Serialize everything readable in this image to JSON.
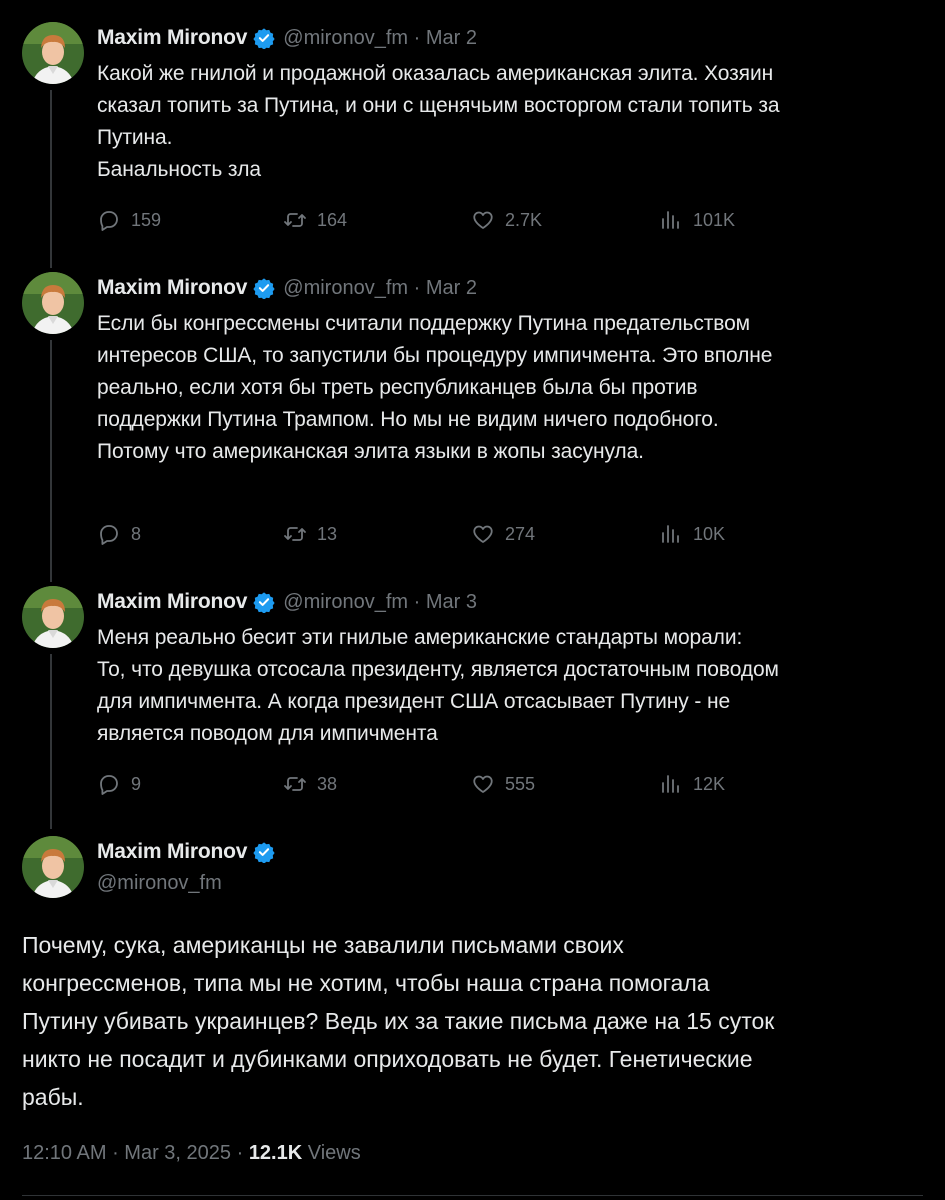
{
  "author": {
    "name": "Maxim Mironov",
    "handle": "@mironov_fm"
  },
  "thread": [
    {
      "date": "Mar 2",
      "lines": [
        "Какой же гнилой и продажной оказалась американская элита. Хозяин",
        "сказал топить за Путина, и они с щенячьим восторгом стали топить за",
        "Путина.",
        "Банальность зла"
      ],
      "replies": "159",
      "reposts": "164",
      "likes": "2.7K",
      "views": "101K"
    },
    {
      "date": "Mar 2",
      "lines": [
        "Если бы конгрессмены считали поддержку Путина предательством",
        "интересов США, то запустили бы процедуру импичмента. Это вполне",
        "реально, если хотя бы треть республиканцев была бы против",
        "поддержки Путина Трампом. Но мы не видим ничего подобного.",
        "Потому что американская элита языки в жопы засунула."
      ],
      "replies": "8",
      "reposts": "13",
      "likes": "274",
      "views": "10K"
    },
    {
      "date": "Mar 3",
      "lines": [
        "Меня реально бесит эти гнилые американские стандарты морали:",
        "То, что девушка отсосала президенту, является достаточным поводом",
        "для импичмента. А когда президент США отсасывает Путину - не",
        "является поводом для импичмента"
      ],
      "replies": "9",
      "reposts": "38",
      "likes": "555",
      "views": "12K"
    }
  ],
  "main_tweet": {
    "lines": [
      "Почему, сука, американцы не завалили письмами своих",
      "конгрессменов, типа мы не хотим, чтобы наша страна помогала",
      "Путину убивать украинцев? Ведь их за такие письма даже на 15 суток",
      "никто не посадит и дубинками оприходовать не будет. Генетические",
      "рабы."
    ],
    "time": "12:10 AM",
    "date": "Mar 3, 2025",
    "views_count": "12.1K",
    "views_label": "Views"
  },
  "colors": {
    "background": "#000000",
    "text": "#e7e9ea",
    "muted": "#71767b",
    "verified": "#1d9bf0"
  },
  "icons": [
    "verified-badge-icon",
    "reply-icon",
    "repost-icon",
    "like-icon",
    "views-icon"
  ]
}
